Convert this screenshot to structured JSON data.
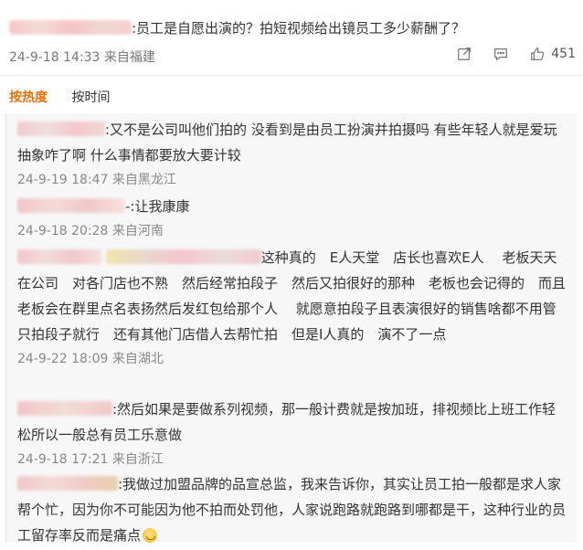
{
  "top_comment": {
    "text": ":员工是自愿出演的？拍短视频给出镜员工多少薪酬了？",
    "date": "24-9-18 14:33 来自福建",
    "likes": "451"
  },
  "sort_tabs": [
    "按热度",
    "按时间"
  ],
  "replies": [
    {
      "text": ":又不是公司叫他们拍的 没看到是由员工扮演并拍摄吗 有些年轻人就是爱玩抽象咋了啊 什么事情都要放大要计较",
      "meta": "24-9-19 18:47 来自黑龙江"
    },
    {
      "text": "-:让我康康",
      "meta": "24-9-18 20:28 来自河南"
    },
    {
      "text": "这种真的　E人天堂　店长也喜欢E人　 老板天天在公司　对各门店也不熟　然后经常拍段子　然后又拍很好的那种　老板也会记得的　而且老板会在群里点名表扬然后发红包给那个人　 就愿意拍段子且表演很好的销售啥都不用管只拍段子就行　还有其他门店借人去帮忙拍　但是I人真的　演不了一点",
      "meta": "24-9-22 18:09 来自湖北"
    },
    {
      "text": ":然后如果是要做系列视频，那一般计费就是按加班，排视频比上班工作轻松所以一般总有员工乐意做",
      "meta": "24-9-18 17:21 来自浙江"
    },
    {
      "text": ":我做过加盟品牌的品宣总监，我来告诉你，其实让员工拍一般都是求人家帮个忙，因为你不可能因为他不拍而处罚他，人家说跑路就跑路到哪都是干，这种行业的员工留存率反而是痛点",
      "emoji": "sweat-smile-emoji"
    }
  ],
  "icons": [
    "share-icon",
    "comment-icon",
    "like-icon"
  ],
  "colors": {
    "accent": "#e8710c",
    "reply_bg": "#f7f7f7",
    "meta_text": "#888888"
  }
}
